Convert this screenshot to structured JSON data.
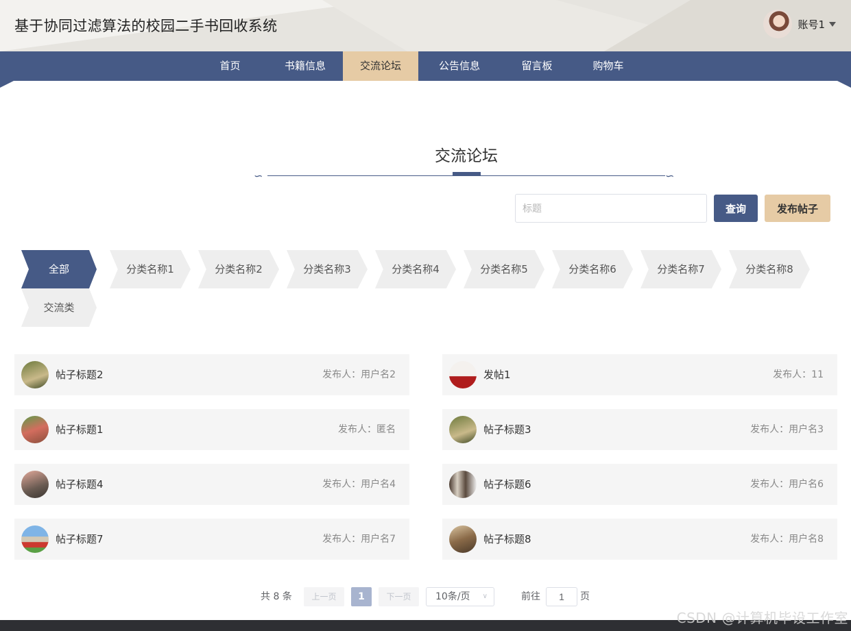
{
  "header": {
    "site_title": "基于协同过滤算法的校园二手书回收系统",
    "user_name": "账号1"
  },
  "nav": {
    "items": [
      {
        "label": "首页",
        "active": false
      },
      {
        "label": "书籍信息",
        "active": false
      },
      {
        "label": "交流论坛",
        "active": true
      },
      {
        "label": "公告信息",
        "active": false
      },
      {
        "label": "留言板",
        "active": false
      },
      {
        "label": "购物车",
        "active": false
      }
    ]
  },
  "page": {
    "title": "交流论坛",
    "search_placeholder": "标题",
    "query_button": "查询",
    "post_button": "发布帖子"
  },
  "categories": [
    {
      "label": "全部",
      "active": true
    },
    {
      "label": "分类名称1",
      "active": false
    },
    {
      "label": "分类名称2",
      "active": false
    },
    {
      "label": "分类名称3",
      "active": false
    },
    {
      "label": "分类名称4",
      "active": false
    },
    {
      "label": "分类名称5",
      "active": false
    },
    {
      "label": "分类名称6",
      "active": false
    },
    {
      "label": "分类名称7",
      "active": false
    },
    {
      "label": "分类名称8",
      "active": false
    },
    {
      "label": "交流类",
      "active": false
    }
  ],
  "posts": [
    {
      "title": "帖子标题2",
      "meta": "发布人：用户名2",
      "thumb": "linear-gradient(160deg,#6d7a3d,#c9b98a 60%,#3f4a25)"
    },
    {
      "title": "发帖1",
      "meta": "发布人：11",
      "thumb": "linear-gradient(180deg,#f4f1ee 0 55%,#b01d1d 56% 100%)"
    },
    {
      "title": "帖子标题1",
      "meta": "发布人：匿名",
      "thumb": "linear-gradient(160deg,#5e9c4a,#d36d5e 50%,#8a4f3c)"
    },
    {
      "title": "帖子标题3",
      "meta": "发布人：用户名3",
      "thumb": "linear-gradient(160deg,#6d7a3d,#c9b98a 60%,#3f4a25)"
    },
    {
      "title": "帖子标题4",
      "meta": "发布人：用户名4",
      "thumb": "linear-gradient(160deg,#e2a99a,#6a5b52 60%,#3b3631)"
    },
    {
      "title": "帖子标题6",
      "meta": "发布人：用户名6",
      "thumb": "linear-gradient(90deg,#4a3a30,#d8cfc2 30%,#5b4a3e 60%,#eee 100%)"
    },
    {
      "title": "帖子标题7",
      "meta": "发布人：用户名7",
      "thumb": "linear-gradient(180deg,#7fb4e6 0 40%,#d3c9b5 41% 60%,#cc3a2f 61% 80%,#5aa045 81%)"
    },
    {
      "title": "帖子标题8",
      "meta": "发布人：用户名8",
      "thumb": "linear-gradient(160deg,#d9c4a1,#8a6a48 50%,#4b3a2a)"
    }
  ],
  "pagination": {
    "total": "共 8 条",
    "prev": "上一页",
    "current": "1",
    "next": "下一页",
    "page_size": "10条/页",
    "goto_label": "前往",
    "goto_value": "1",
    "goto_unit": "页"
  },
  "watermark": "CSDN @计算机毕设工作室",
  "colors": {
    "primary": "#465a86",
    "accent": "#e6cba5",
    "item_bg": "#f5f5f5"
  }
}
